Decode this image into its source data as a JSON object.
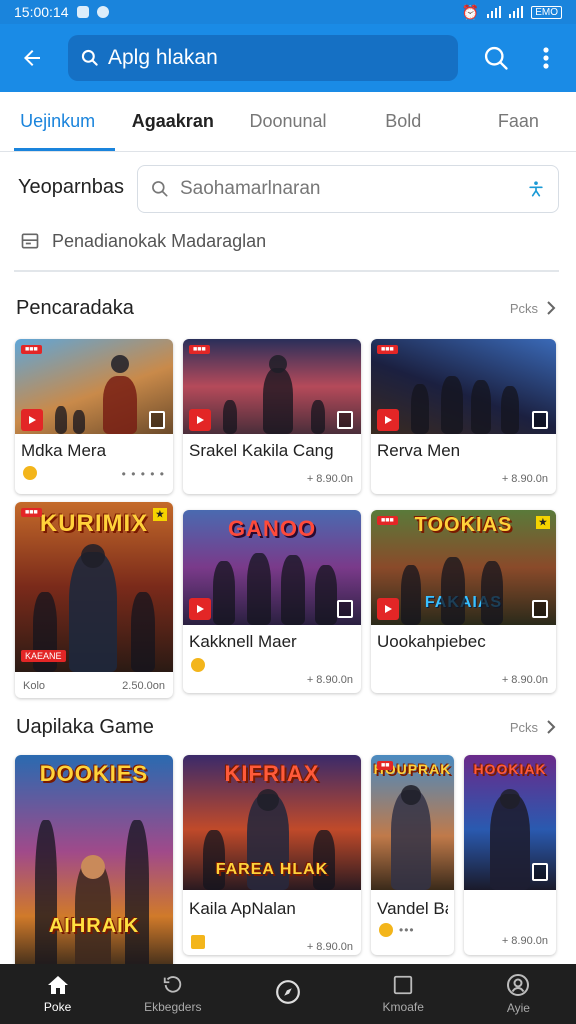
{
  "status": {
    "time": "15:00:14",
    "battery": "EMO"
  },
  "appbar": {
    "search_text": "Aplg hlakan"
  },
  "tabs": [
    {
      "label": "Uejinkum"
    },
    {
      "label": "Agaakran"
    },
    {
      "label": "Doonunal"
    },
    {
      "label": "Bold"
    },
    {
      "label": "Faan"
    }
  ],
  "filter": {
    "label": "Yeoparnbas",
    "search_placeholder": "Saohamarlnaran"
  },
  "recommend": {
    "label": "Penadianokak Madaraglan"
  },
  "section1": {
    "title": "Pencaradaka",
    "more": "Pcks",
    "cards": [
      {
        "name": "Mdka Mera",
        "meta": "",
        "art_title": "",
        "dots": "• • • • •"
      },
      {
        "name": "Srakel Kakila Cang",
        "meta": "+ 8.90.0n",
        "art_title": ""
      },
      {
        "name": "Rerva Men",
        "meta": "+ 8.90.0n",
        "art_title": ""
      },
      {
        "name": "",
        "meta": "2.50.0on",
        "left_meta": "Kolo",
        "art_title": "KURIMIX",
        "art_sub": "KAEANE"
      },
      {
        "name": "Kakknell Maer",
        "meta": "+ 8.90.0n",
        "art_title": "GANOO"
      },
      {
        "name": "Uookahpiebec",
        "meta": "+ 8.90.0n",
        "art_title": "TOOKIAS",
        "art_sub": "FAKAIAS"
      }
    ]
  },
  "section2": {
    "title": "Uapilaka Game",
    "more": "Pcks",
    "cards": [
      {
        "name": "",
        "art_title": "DOOKIES",
        "art_sub": "AIHRAIK"
      },
      {
        "name": "Kaila ApNalan",
        "meta": "+ 8.90.0n",
        "art_title": "KIFRIAX",
        "art_sub": "FAREA HLAK"
      },
      {
        "name": "Vandel Ba",
        "art_title": "HOUPRAK"
      },
      {
        "name": "",
        "meta": "+ 8.90.0n",
        "art_title": "HOOKIAK"
      }
    ]
  },
  "bottomnav": [
    {
      "label": "Poke",
      "icon": "home-icon"
    },
    {
      "label": "Ekbegders",
      "icon": "history-icon"
    },
    {
      "label": "",
      "icon": "compass-icon"
    },
    {
      "label": "Kmoafe",
      "icon": "square-icon"
    },
    {
      "label": "Ayie",
      "icon": "profile-icon"
    }
  ],
  "colors": {
    "primary": "#1a8be6",
    "primary_dark": "#1570c4",
    "accent_red": "#e32626",
    "nav_bg": "#1f1f1f"
  }
}
